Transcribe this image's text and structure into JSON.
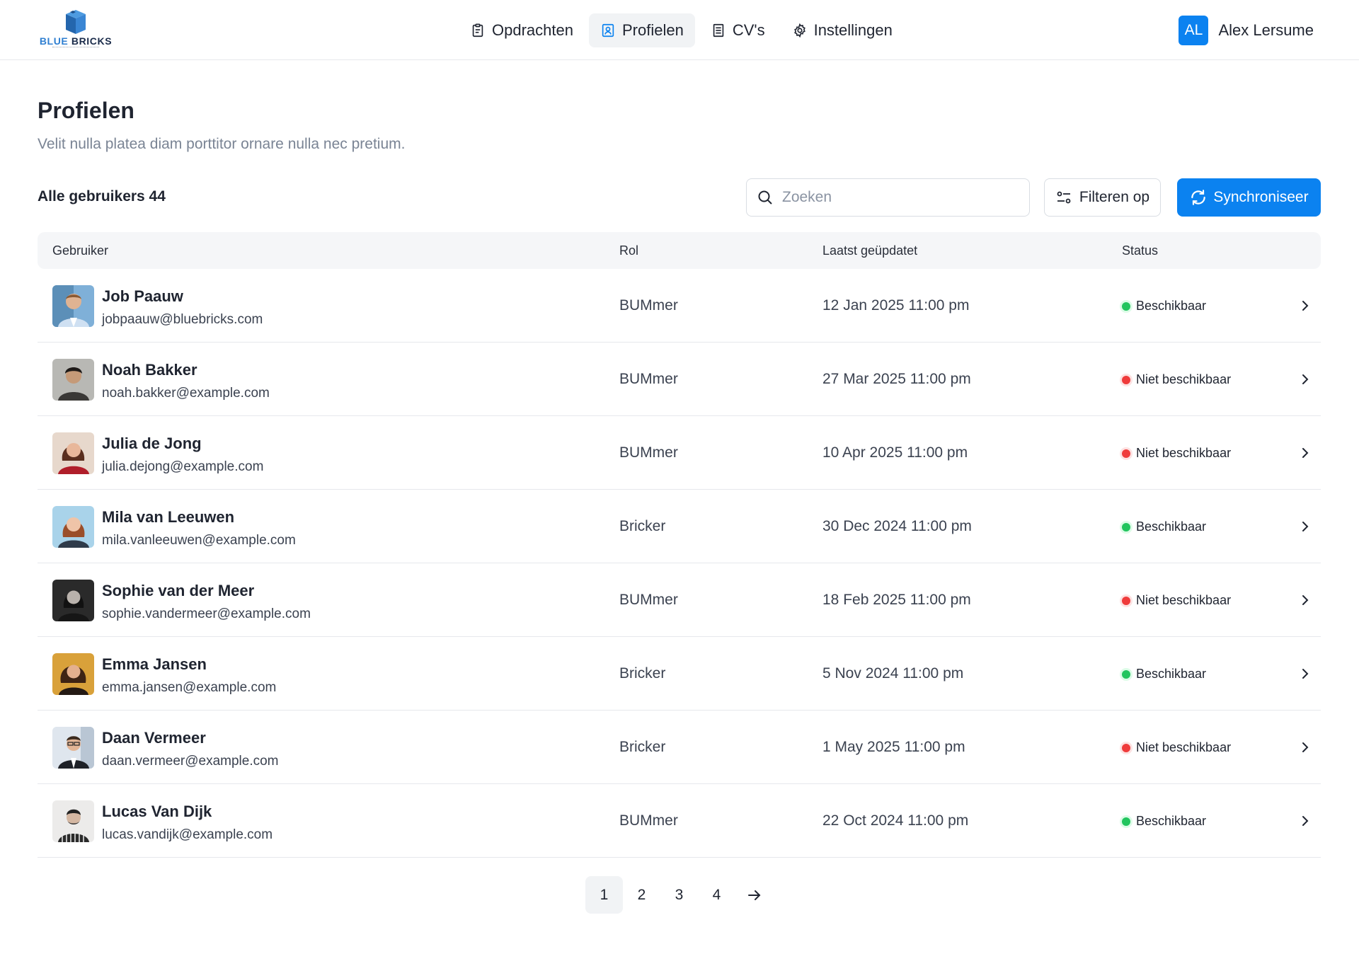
{
  "header": {
    "logo": {
      "brand_part1": "BLUE",
      "brand_part2": "BRICKS"
    },
    "nav": [
      {
        "label": "Opdrachten",
        "icon": "clipboard-icon"
      },
      {
        "label": "Profielen",
        "icon": "contact-card-icon",
        "active": true
      },
      {
        "label": "CV's",
        "icon": "document-icon"
      },
      {
        "label": "Instellingen",
        "icon": "gear-icon"
      }
    ],
    "user": {
      "initials": "AL",
      "name": "Alex Lersume"
    }
  },
  "page": {
    "title": "Profielen",
    "subtitle": "Velit nulla platea diam porttitor ornare nulla nec pretium."
  },
  "toolbar": {
    "count_label": "Alle gebruikers 44",
    "search_placeholder": "Zoeken",
    "filter_label": "Filteren op",
    "sync_label": "Synchroniseer"
  },
  "table": {
    "columns": [
      "Gebruiker",
      "Rol",
      "Laatst geüpdatet",
      "Status"
    ],
    "rows": [
      {
        "name": "Job Paauw",
        "email": "jobpaauw@bluebricks.com",
        "role": "BUMmer",
        "updated": "12 Jan 2025 11:00 pm",
        "status": "Beschikbaar",
        "available": true
      },
      {
        "name": "Noah Bakker",
        "email": "noah.bakker@example.com",
        "role": "BUMmer",
        "updated": "27 Mar 2025 11:00 pm",
        "status": "Niet beschikbaar",
        "available": false
      },
      {
        "name": "Julia de Jong",
        "email": "julia.dejong@example.com",
        "role": "BUMmer",
        "updated": "10 Apr 2025 11:00 pm",
        "status": "Niet beschikbaar",
        "available": false
      },
      {
        "name": "Mila van Leeuwen",
        "email": "mila.vanleeuwen@example.com",
        "role": "Bricker",
        "updated": "30 Dec 2024 11:00 pm",
        "status": "Beschikbaar",
        "available": true
      },
      {
        "name": "Sophie van der Meer",
        "email": "sophie.vandermeer@example.com",
        "role": "BUMmer",
        "updated": "18 Feb 2025 11:00 pm",
        "status": "Niet beschikbaar",
        "available": false
      },
      {
        "name": "Emma Jansen",
        "email": "emma.jansen@example.com",
        "role": "Bricker",
        "updated": "5 Nov 2024 11:00 pm",
        "status": "Beschikbaar",
        "available": true
      },
      {
        "name": "Daan Vermeer",
        "email": "daan.vermeer@example.com",
        "role": "Bricker",
        "updated": "1 May 2025 11:00 pm",
        "status": "Niet beschikbaar",
        "available": false
      },
      {
        "name": "Lucas Van Dijk",
        "email": "lucas.vandijk@example.com",
        "role": "BUMmer",
        "updated": "22 Oct 2024 11:00 pm",
        "status": "Beschikbaar",
        "available": true
      }
    ]
  },
  "pagination": {
    "pages": [
      "1",
      "2",
      "3",
      "4"
    ],
    "current": "1"
  },
  "colors": {
    "accent": "#0b82f0",
    "available": "#22c55e",
    "unavailable": "#ef3b3b",
    "header_bg": "#f5f6f8"
  }
}
